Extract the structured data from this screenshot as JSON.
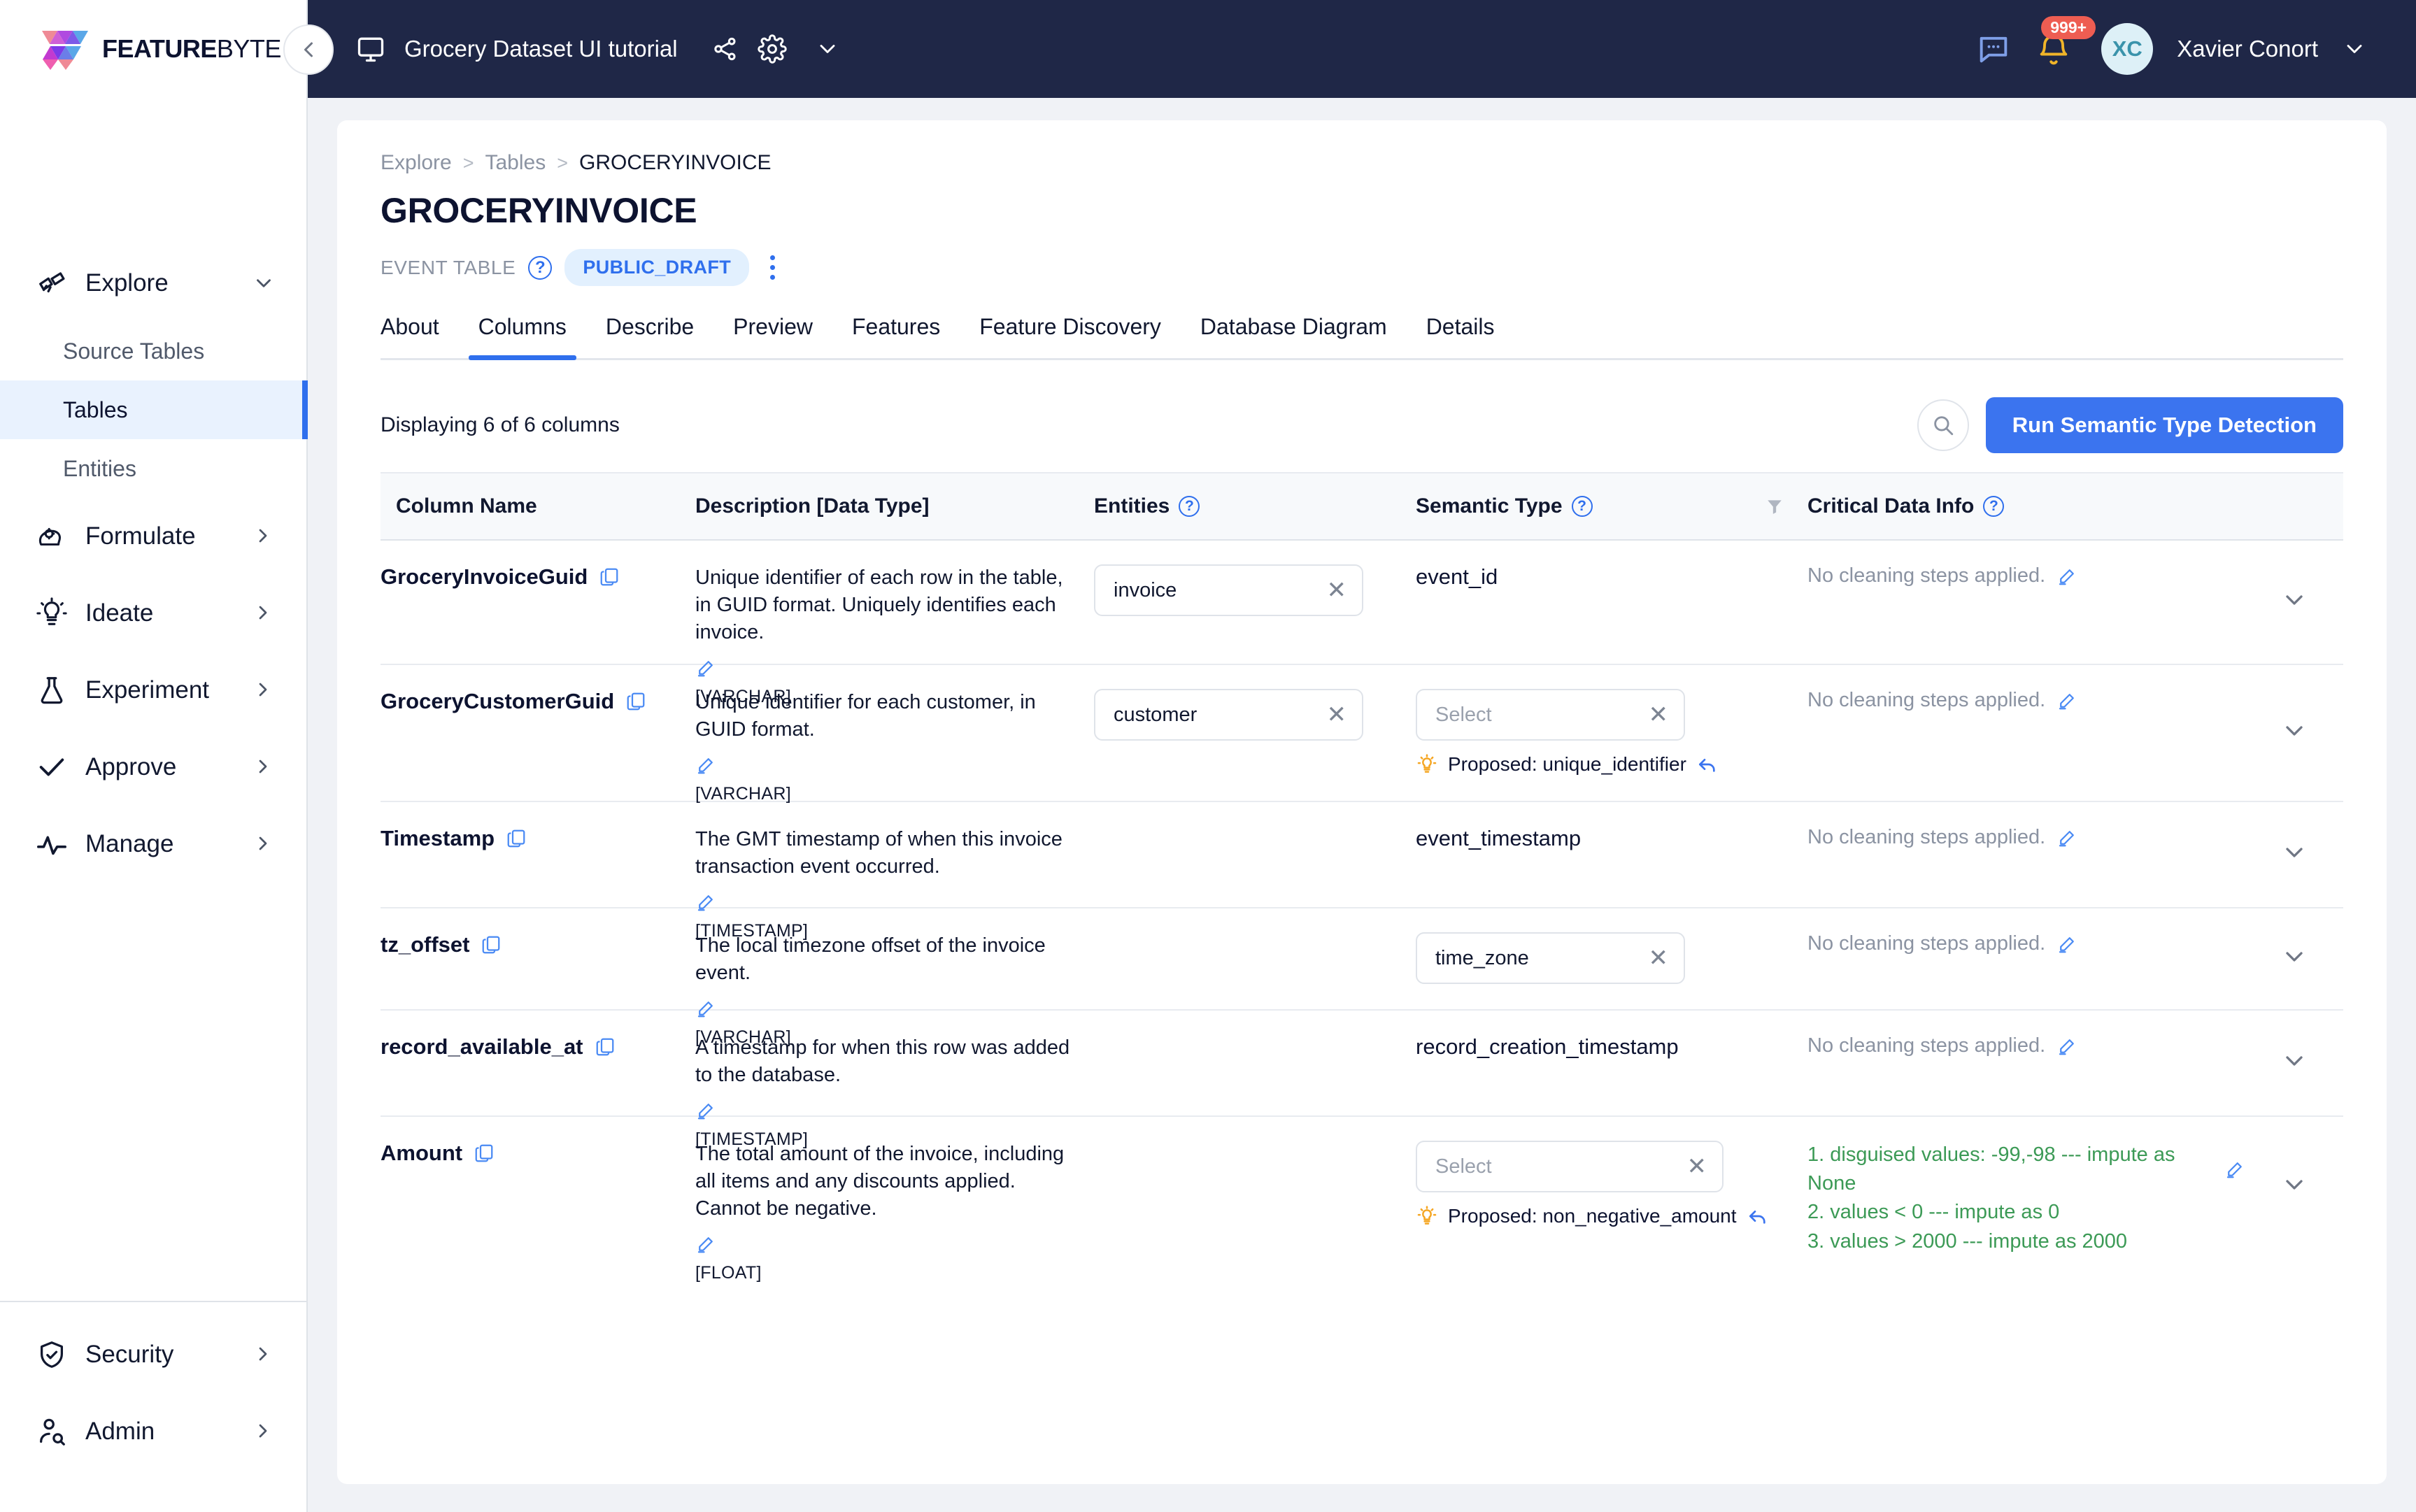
{
  "brand": {
    "name_bold": "FEATURE",
    "name_light": "BYTE",
    "logo_icon": "featurebyte-logo"
  },
  "topbar": {
    "workspace_title": "Grocery Dataset UI tutorial",
    "monitor_icon": "monitor-icon",
    "share_icon": "share-icon",
    "settings_icon": "gear-icon",
    "chevron_icon": "chevron-down-icon",
    "chat_icon": "chat-icon",
    "bell_icon": "bell-icon",
    "notification_count": "999+",
    "avatar_initials": "XC",
    "user_name": "Xavier Conort",
    "user_chevron_icon": "chevron-down-icon",
    "collapse_icon": "chevron-left-icon"
  },
  "sidebar": {
    "groups": [
      {
        "label": "Explore",
        "icon": "telescope-icon",
        "chevron": "chevron-down-icon",
        "expanded": true,
        "children": [
          {
            "label": "Source Tables",
            "active": false
          },
          {
            "label": "Tables",
            "active": true
          },
          {
            "label": "Entities",
            "active": false
          }
        ]
      },
      {
        "label": "Formulate",
        "icon": "brain-gear-icon",
        "chevron": "chevron-right-icon",
        "children": []
      },
      {
        "label": "Ideate",
        "icon": "lightbulb-icon",
        "chevron": "chevron-right-icon",
        "children": []
      },
      {
        "label": "Experiment",
        "icon": "flask-icon",
        "chevron": "chevron-right-icon",
        "children": []
      },
      {
        "label": "Approve",
        "icon": "check-icon",
        "chevron": "chevron-right-icon",
        "children": []
      },
      {
        "label": "Manage",
        "icon": "activity-icon",
        "chevron": "chevron-right-icon",
        "children": []
      }
    ],
    "bottom": [
      {
        "label": "Security",
        "icon": "shield-check-icon",
        "chevron": "chevron-right-icon"
      },
      {
        "label": "Admin",
        "icon": "user-search-icon",
        "chevron": "chevron-right-icon"
      }
    ]
  },
  "breadcrumb": {
    "item1": "Explore",
    "sep1": ">",
    "item2": "Tables",
    "sep2": ">",
    "current": "GROCERYINVOICE"
  },
  "page": {
    "title": "GROCERYINVOICE",
    "type_label": "EVENT TABLE",
    "type_help_icon": "question-circle-icon",
    "status": "PUBLIC_DRAFT",
    "kebab_icon": "more-vertical-icon"
  },
  "tabs": [
    {
      "label": "About",
      "active": false
    },
    {
      "label": "Columns",
      "active": true
    },
    {
      "label": "Describe",
      "active": false
    },
    {
      "label": "Preview",
      "active": false
    },
    {
      "label": "Features",
      "active": false
    },
    {
      "label": "Feature Discovery",
      "active": false
    },
    {
      "label": "Database Diagram",
      "active": false
    },
    {
      "label": "Details",
      "active": false
    }
  ],
  "toolbar": {
    "displaying": "Displaying 6 of 6 columns",
    "search_icon": "search-icon",
    "run_detection_label": "Run Semantic Type Detection"
  },
  "table": {
    "headers": {
      "column_name": "Column Name",
      "description": "Description [Data Type]",
      "entities": "Entities",
      "entities_help_icon": "question-circle-icon",
      "semantic_type": "Semantic Type",
      "semantic_help_icon": "question-circle-icon",
      "filter_icon": "filter-icon",
      "critical_data_info": "Critical Data Info",
      "cdi_help_icon": "question-circle-icon"
    },
    "rows": [
      {
        "name": "GroceryInvoiceGuid",
        "copy_icon": "copy-icon",
        "description": "Unique identifier of each row in the table, in GUID format. Uniquely identifies each invoice.",
        "edit_icon": "edit-pencil-icon",
        "data_type": "[VARCHAR]",
        "entity_chip": "invoice",
        "entity_clear_icon": "close-x-icon",
        "semantic_value": "event_id",
        "semantic_kind": "static",
        "proposed": null,
        "cdi_text": "No cleaning steps applied.",
        "cdi_edit_icon": "edit-pencil-icon",
        "cleaning_steps": [],
        "expand_icon": "chevron-down-icon"
      },
      {
        "name": "GroceryCustomerGuid",
        "copy_icon": "copy-icon",
        "description": "Unique identifier for each customer, in GUID format.",
        "edit_icon": "edit-pencil-icon",
        "data_type": "[VARCHAR]",
        "entity_chip": "customer",
        "entity_clear_icon": "close-x-icon",
        "semantic_value": "Select",
        "semantic_kind": "select",
        "semantic_clear_icon": "close-x-icon",
        "proposed": "Proposed: unique_identifier",
        "proposed_bulb_icon": "lightbulb-icon",
        "proposed_undo_icon": "undo-arrow-icon",
        "cdi_text": "No cleaning steps applied.",
        "cdi_edit_icon": "edit-pencil-icon",
        "cleaning_steps": [],
        "expand_icon": "chevron-down-icon"
      },
      {
        "name": "Timestamp",
        "copy_icon": "copy-icon",
        "description": "The GMT timestamp of when this invoice transaction event occurred.",
        "edit_icon": "edit-pencil-icon",
        "data_type": "[TIMESTAMP]",
        "entity_chip": null,
        "semantic_value": "event_timestamp",
        "semantic_kind": "static",
        "proposed": null,
        "cdi_text": "No cleaning steps applied.",
        "cdi_edit_icon": "edit-pencil-icon",
        "cleaning_steps": [],
        "expand_icon": "chevron-down-icon"
      },
      {
        "name": "tz_offset",
        "copy_icon": "copy-icon",
        "description": "The local timezone offset of the invoice event.",
        "edit_icon": "edit-pencil-icon",
        "data_type": "[VARCHAR]",
        "entity_chip": null,
        "semantic_value": "time_zone",
        "semantic_kind": "chip",
        "semantic_clear_icon": "close-x-icon",
        "proposed": null,
        "cdi_text": "No cleaning steps applied.",
        "cdi_edit_icon": "edit-pencil-icon",
        "cleaning_steps": [],
        "expand_icon": "chevron-down-icon"
      },
      {
        "name": "record_available_at",
        "copy_icon": "copy-icon",
        "description": "A timestamp for when this row was added to the database.",
        "edit_icon": "edit-pencil-icon",
        "data_type": "[TIMESTAMP]",
        "entity_chip": null,
        "semantic_value": "record_creation_timestamp",
        "semantic_kind": "static",
        "proposed": null,
        "cdi_text": "No cleaning steps applied.",
        "cdi_edit_icon": "edit-pencil-icon",
        "cleaning_steps": [],
        "expand_icon": "chevron-down-icon"
      },
      {
        "name": "Amount",
        "copy_icon": "copy-icon",
        "description": "The total amount of the invoice, including all items and any discounts applied. Cannot be negative.",
        "edit_icon": "edit-pencil-icon",
        "data_type": "[FLOAT]",
        "entity_chip": null,
        "semantic_value": "Select",
        "semantic_kind": "select",
        "semantic_clear_icon": "close-x-icon",
        "proposed": "Proposed: non_negative_amount",
        "proposed_bulb_icon": "lightbulb-icon",
        "proposed_undo_icon": "undo-arrow-icon",
        "cdi_text": null,
        "cdi_edit_icon": "edit-pencil-icon",
        "cleaning_steps": [
          "1. disguised values: -99,-98 --- impute as None",
          "2. values < 0 --- impute as 0",
          "3. values > 2000 --- impute as 2000"
        ],
        "expand_icon": "chevron-down-icon"
      }
    ]
  },
  "colors": {
    "accent": "#3b74ef",
    "topbar_bg": "#1f2747",
    "status_pill_bg": "#e2f0fe",
    "badge_red": "#ee5d52",
    "clean_green": "#3c9a56",
    "bulb_orange": "#f5a623"
  }
}
